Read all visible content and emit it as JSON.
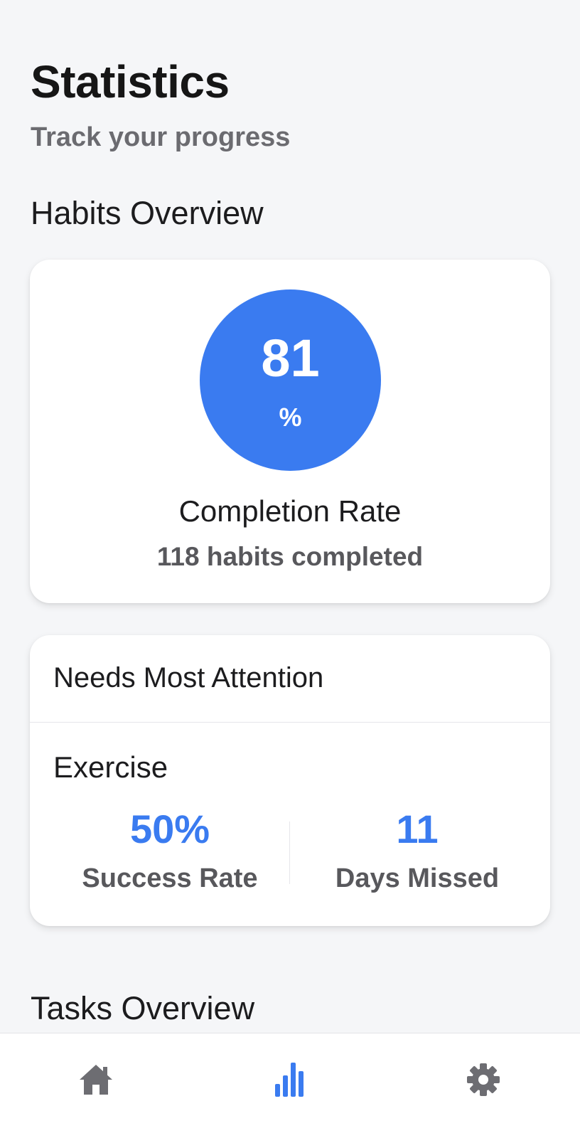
{
  "header": {
    "title": "Statistics",
    "subtitle": "Track your progress"
  },
  "habits_overview": {
    "title": "Habits Overview",
    "completion_value": "81",
    "completion_unit": "%",
    "completion_label": "Completion Rate",
    "completion_detail": "118 habits completed"
  },
  "needs_attention": {
    "title": "Needs Most Attention",
    "habit_name": "Exercise",
    "success_rate_value": "50%",
    "success_rate_label": "Success Rate",
    "days_missed_value": "11",
    "days_missed_label": "Days Missed"
  },
  "tasks_overview": {
    "title": "Tasks Overview"
  },
  "bottom_nav": {
    "items": [
      {
        "icon": "home-icon",
        "active": false
      },
      {
        "icon": "bar-chart-icon",
        "active": true
      },
      {
        "icon": "gear-icon",
        "active": false
      }
    ]
  },
  "colors": {
    "accent": "#3a7bf0",
    "background": "#f5f6f8",
    "inactive_icon": "#6d6d72"
  }
}
